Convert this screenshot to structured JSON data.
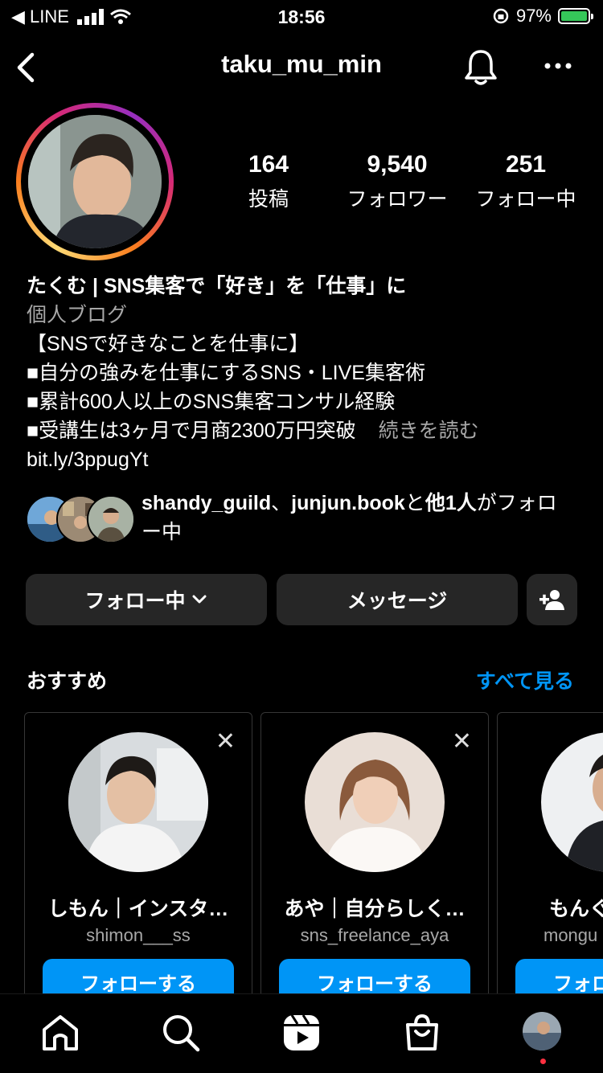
{
  "status_bar": {
    "back_app": "◀ LINE",
    "time": "18:56",
    "battery": "97%"
  },
  "header": {
    "username": "taku_mu_min"
  },
  "stats": [
    {
      "value": "164",
      "label": "投稿"
    },
    {
      "value": "9,540",
      "label": "フォロワー"
    },
    {
      "value": "251",
      "label": "フォロー中"
    }
  ],
  "bio": {
    "name": "たくむ | SNS集客で「好き」を「仕事」に",
    "category": "個人ブログ",
    "lines": [
      "【SNSで好きなことを仕事に】",
      "■自分の強みを仕事にするSNS・LIVE集客術",
      "■累計600人以上のSNS集客コンサル経験",
      "■受講生は3ヶ月で月商2300万円突破"
    ],
    "more": "続きを読む",
    "link": "bit.ly/3ppugYt"
  },
  "followed_by": {
    "user1": "shandy_guild",
    "sep": "、",
    "user2": "junjun.book",
    "suffix1": "と",
    "others": "他1人",
    "suffix2": "がフォロー中"
  },
  "actions": {
    "following": "フォロー中",
    "message": "メッセージ"
  },
  "suggestions": {
    "title": "おすすめ",
    "see_all": "すべて見る",
    "cards": [
      {
        "name": "しもん｜インスタ…",
        "username": "shimon___ss",
        "follow": "フォローする"
      },
      {
        "name": "あや｜自分らしく…",
        "username": "sns_freelance_aya",
        "follow": "フォローする"
      },
      {
        "name": "もんぐ",
        "username": "mongu",
        "follow": "フォロ"
      }
    ]
  },
  "tabs": [
    "home-icon",
    "search-icon",
    "reels-icon",
    "shop-icon",
    "profile-avatar"
  ]
}
